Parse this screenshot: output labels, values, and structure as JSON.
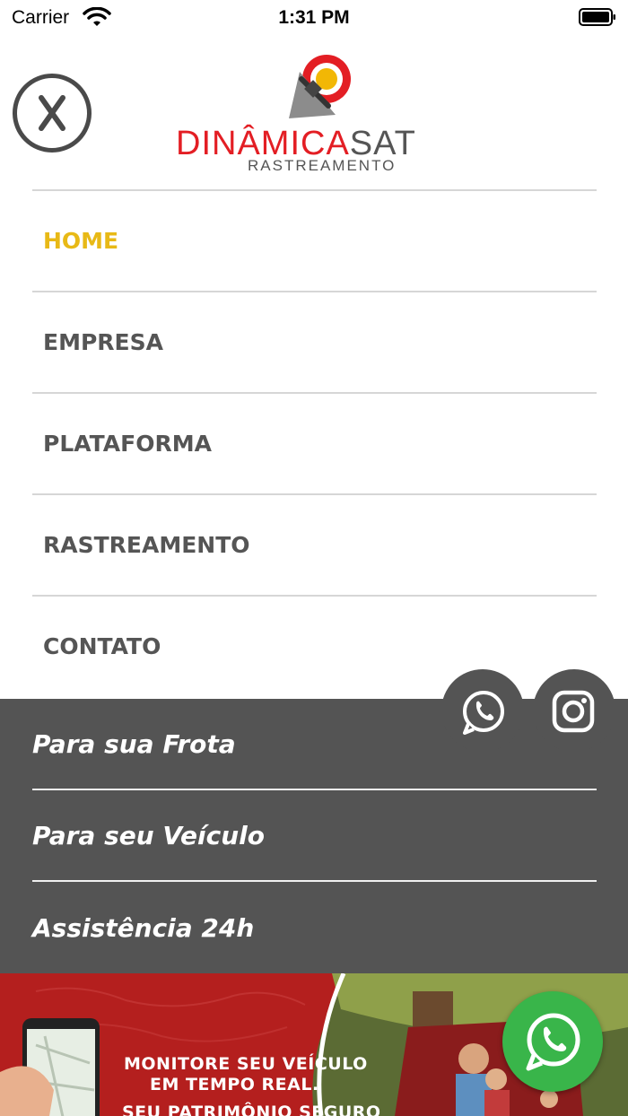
{
  "status_bar": {
    "carrier": "Carrier",
    "time": "1:31 PM"
  },
  "header": {
    "logo_word_red": "DINÂMICA",
    "logo_word_gray": "SAT",
    "logo_subtitle": "RASTREAMENTO"
  },
  "nav": {
    "items": [
      {
        "label": "HOME",
        "active": true
      },
      {
        "label": "EMPRESA"
      },
      {
        "label": "PLATAFORMA"
      },
      {
        "label": "RASTREAMENTO"
      },
      {
        "label": "CONTATO"
      }
    ]
  },
  "sub_menu": {
    "items": [
      {
        "label": "Para sua Frota"
      },
      {
        "label": "Para seu Veículo"
      },
      {
        "label": "Assistência 24h"
      }
    ]
  },
  "banner": {
    "line1": "MONITORE SEU VEÍCULO",
    "line2": "EM TEMPO REAL.",
    "line3": "SEU PATRIMÔNIO SEGURO"
  },
  "icons": {
    "close": "close-icon",
    "whatsapp": "whatsapp-icon",
    "instagram": "instagram-icon"
  },
  "colors": {
    "active_nav": "#e8b916",
    "panel": "#545454",
    "brand_red": "#e31e24",
    "whatsapp_green": "#39b54a"
  }
}
